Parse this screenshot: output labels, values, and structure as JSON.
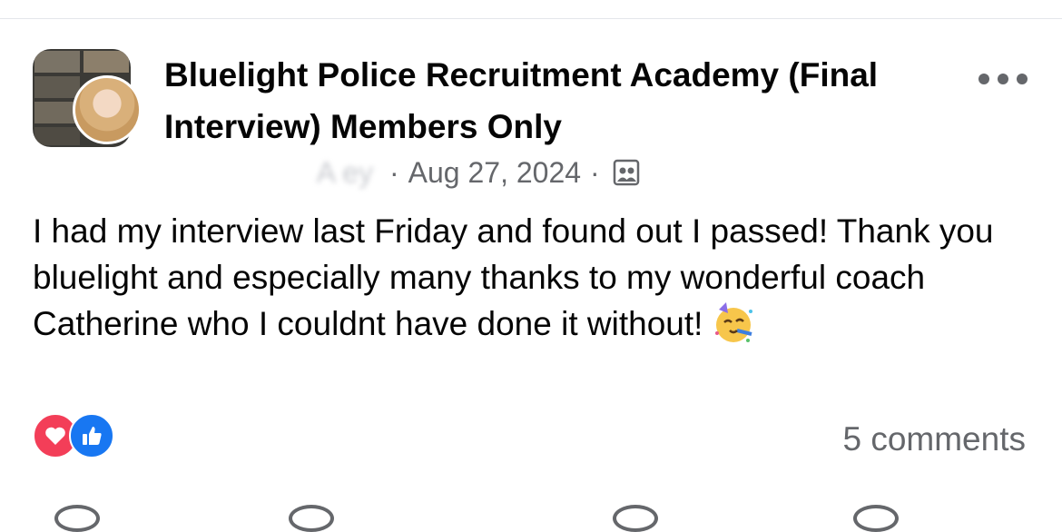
{
  "post": {
    "group_name": "Bluelight Police Recruitment Academy (Final Interview) Members Only",
    "author_name": "A                ey",
    "meta_separator": "·",
    "date": "Aug 27, 2024",
    "audience_icon": "members-only-icon",
    "text": "I had my interview last Friday and found out I passed! Thank you bluelight and especially many thanks to my wonderful coach Catherine who I couldnt have done it without!",
    "emoji": "partying-face-emoji",
    "more_icon": "more-options-icon"
  },
  "footer": {
    "reactions": [
      "love",
      "like"
    ],
    "comments_label": "5 comments"
  },
  "colors": {
    "text_primary": "#050505",
    "text_secondary": "#65676b",
    "like_blue": "#1877f2",
    "love_red": "#f33e58",
    "divider": "#e4e6eb"
  }
}
